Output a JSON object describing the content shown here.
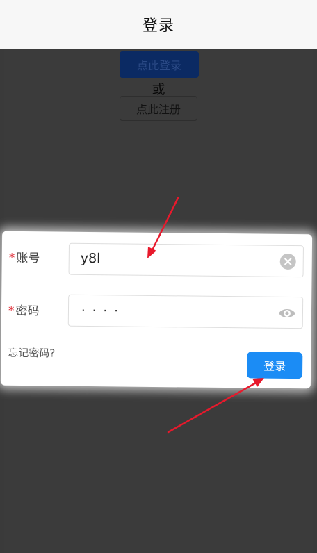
{
  "header": {
    "title": "登录"
  },
  "background": {
    "login_button": "点此登录",
    "or_text": "或",
    "register_button": "点此注册"
  },
  "form": {
    "account": {
      "required_mark": "*",
      "label": "账号",
      "value": "y8l"
    },
    "password": {
      "required_mark": "*",
      "label": "密码",
      "masked_value": "····"
    },
    "forgot_link": "忘记密码?",
    "submit_button": "登录"
  },
  "colors": {
    "primary": "#1b8cf5",
    "required": "#e0303a",
    "annotation_arrow": "#e8192c"
  },
  "icons": [
    "clear-icon",
    "eye-icon"
  ]
}
